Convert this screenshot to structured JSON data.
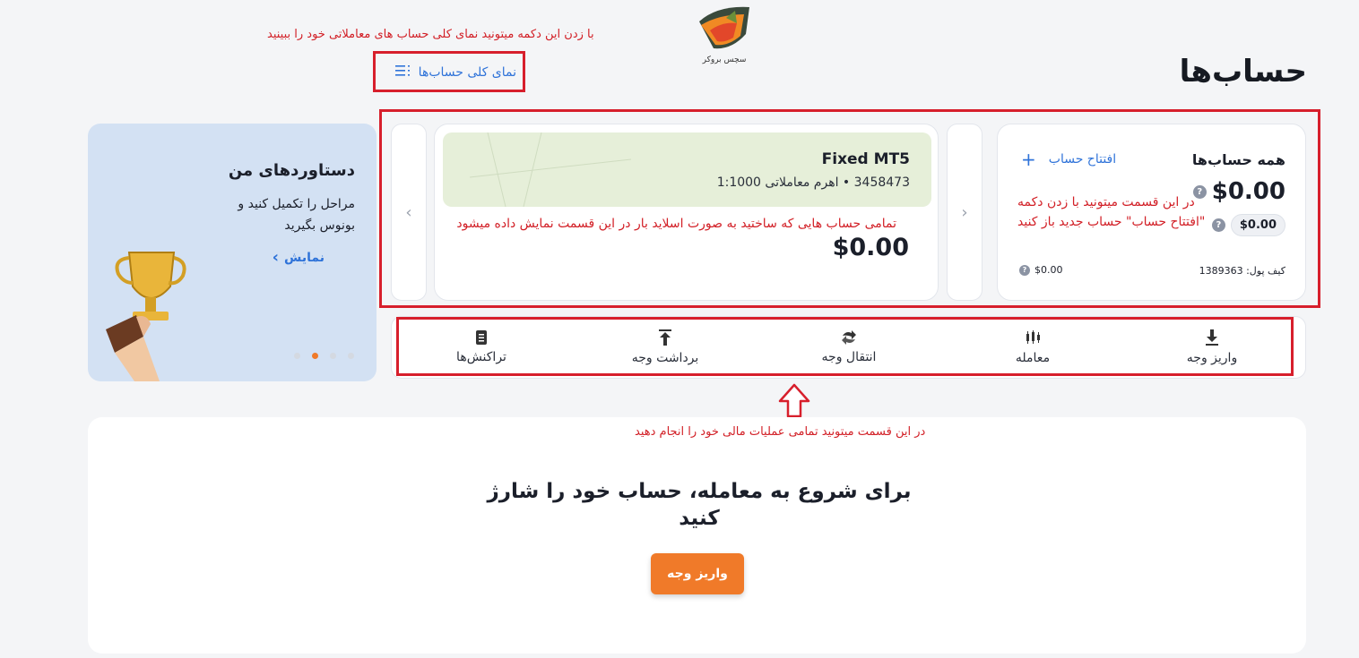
{
  "header": {
    "title": "حساب‌ها",
    "overview_label": "نمای کلی حساب‌ها",
    "overview_note": "با زدن این دکمه میتونید نمای کلی حساب های معاملاتی خود را ببینید",
    "logo_text": "سچس بروکر"
  },
  "summary": {
    "title": "همه حساب‌ها",
    "open_account_label": "افتتاح حساب",
    "balance": "$0.00",
    "sub_balance": "$0.00",
    "wallet_label": "کیف پول: 1389363",
    "wallet_value": "$0.00",
    "note_line1": "در این قسمت میتونید با زدن دکمه",
    "note_line2": "\"افتتاح حساب\" حساب جدید باز کنید"
  },
  "account_card": {
    "name": "Fixed MT5",
    "details": "3458473 • اهرم معاملاتی 1:1000",
    "balance": "$0.00",
    "note": "تمامی حساب هایی که ساختید به صورت اسلاید بار در این قسمت نمایش داده میشود"
  },
  "achievements": {
    "title": "دستاوردهای من",
    "body_line1": "مراحل را تکمیل کنید و",
    "body_line2": "بونوس بگیرید",
    "link_label": "نمایش"
  },
  "operations": {
    "items": [
      {
        "label": "واریز وجه",
        "icon": "deposit-icon"
      },
      {
        "label": "معامله",
        "icon": "trade-icon"
      },
      {
        "label": "انتقال وجه",
        "icon": "transfer-icon"
      },
      {
        "label": "برداشت وجه",
        "icon": "withdraw-icon"
      },
      {
        "label": "تراکنش‌ها",
        "icon": "transactions-icon"
      }
    ],
    "note": "در این قسمت میتونید تمامی عملیات مالی خود را انجام دهید"
  },
  "cta": {
    "heading_line1": "برای شروع به معامله، حساب خود را شارژ",
    "heading_line2": "کنید",
    "button_label": "واریز وجه"
  },
  "colors": {
    "accent": "#f07a29",
    "link": "#2f73d9",
    "annotation": "#d71f2c",
    "account_card_bg": "#e6efd9",
    "promo_bg": "#d3e1f3"
  }
}
